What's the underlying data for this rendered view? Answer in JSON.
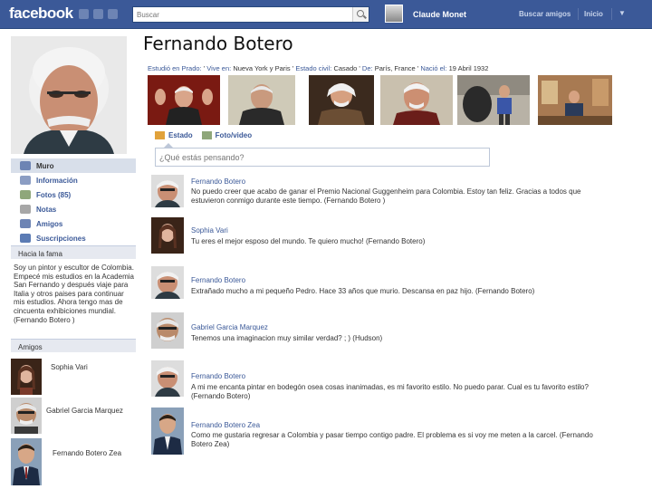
{
  "topbar": {
    "logo": "facebook",
    "search_placeholder": "Buscar",
    "user": "Claude Monet",
    "links": [
      "Buscar amigos",
      "Inicio"
    ]
  },
  "profile": {
    "name": "Fernando Botero",
    "info": {
      "studied_label": "Estudió en Prado:",
      "studied_value": "'",
      "lives_label": "Vive en:",
      "lives_value": "Nueva York y Paris",
      "status_label": "Estado civil:",
      "status_value": "Casado",
      "from_label": "De:",
      "from_value": "París, France",
      "born_label": "Nació el:",
      "born_value": "19 Abril 1932"
    }
  },
  "sidebar": {
    "items": [
      {
        "label": "Muro",
        "icon": "wall-icon"
      },
      {
        "label": "Información",
        "icon": "info-icon"
      },
      {
        "label": "Fotos (85)",
        "icon": "photos-icon"
      },
      {
        "label": "Notas",
        "icon": "notes-icon"
      },
      {
        "label": "Amigos",
        "icon": "friends-icon"
      },
      {
        "label": "Suscripciones",
        "icon": "subscriptions-icon"
      }
    ],
    "about_heading": "Hacia la fama",
    "bio": "Soy un pintor y escultor de Colombia. Empecé mis estudios en la Academia San Fernando y después viaje para Italia y otros paises para continuar mis estudios. Ahora tengo mas de cincuenta exhibiciones mundial. (Fernando Botero )",
    "friends_heading": "Amigos",
    "friends": [
      "Sophia Vari",
      "Gabriel Garcia Marquez",
      "Fernando Botero Zea"
    ]
  },
  "composer": {
    "tab_status": "Estado",
    "tab_photo": "Foto/video",
    "placeholder": "¿Qué estás pensando?"
  },
  "posts": [
    {
      "author": "Fernando Botero",
      "text": "No puedo creer que acabo de ganar el Premio Nacional Guggenheim para Colombia. Estoy tan feliz. Gracias a todos que estuvieron conmigo durante este tiempo. (Fernando Botero )"
    },
    {
      "author": "Sophia Vari",
      "text": "Tu eres el mejor esposo del mundo. Te quiero mucho! (Fernando Botero)"
    },
    {
      "author": "Fernando Botero",
      "text": "Extrañado mucho a mi pequeño Pedro. Hace 33 años que murio. Descansa en paz hijo. (Fernando Botero)"
    },
    {
      "author": "Gabriel Garcia Marquez",
      "text": "Tenemos una imaginacion muy similar verdad? ; ) (Hudson)"
    },
    {
      "author": "Fernando Botero",
      "text": "A mi me encanta pintar en bodegón osea cosas inanimadas, es mi favorito estilo. No puedo parar. Cual es tu favorito estilo? (Fernando Botero)"
    },
    {
      "author": "Fernando Botero Zea",
      "text": "Como me gustaria regresar a Colombia y pasar tiempo contigo padre. El problema es si voy me meten a la carcel. (Fernando Botero Zea)"
    }
  ],
  "colors": {
    "brand": "#3b5998",
    "link": "#3b5998",
    "nav_active": "#d8dfea"
  }
}
